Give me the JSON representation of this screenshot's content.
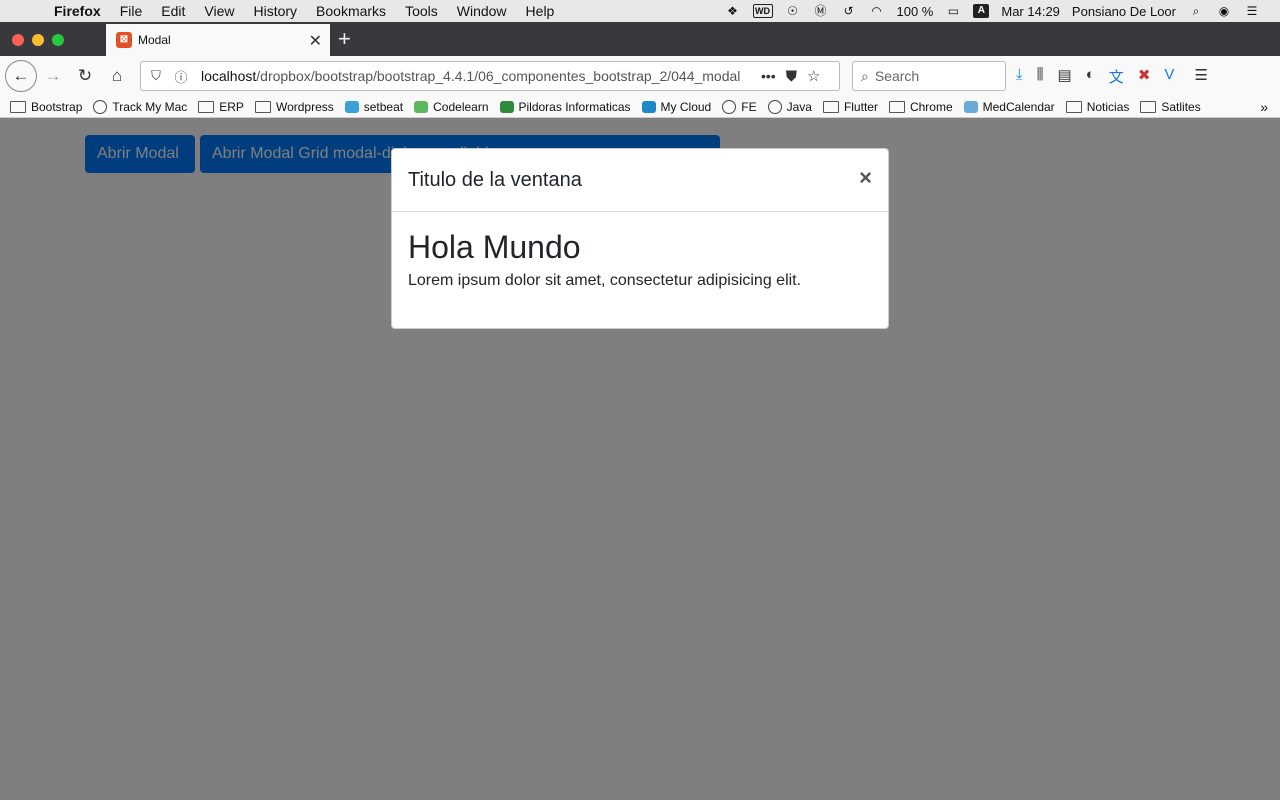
{
  "menubar": {
    "app": "Firefox",
    "items": [
      "File",
      "Edit",
      "View",
      "History",
      "Bookmarks",
      "Tools",
      "Window",
      "Help"
    ],
    "battery": "100 %",
    "input_source": "A",
    "clock": "Mar 14:29",
    "user": "Ponsiano De Loor"
  },
  "tab": {
    "title": "Modal"
  },
  "navbar": {
    "url_host": "localhost",
    "url_path": "/dropbox/bootstrap/bootstrap_4.4.1/06_componentes_bootstrap_2/044_modal",
    "search_placeholder": "Search"
  },
  "bookmarks": {
    "items": [
      {
        "label": "Bootstrap",
        "icon": "folder-icon"
      },
      {
        "label": "Track My Mac",
        "icon": "globe-icon"
      },
      {
        "label": "ERP",
        "icon": "folder-icon"
      },
      {
        "label": "Wordpress",
        "icon": "folder-icon"
      },
      {
        "label": "setbeat",
        "icon": "setbeat-icon"
      },
      {
        "label": "Codelearn",
        "icon": "codelearn-icon"
      },
      {
        "label": "Pildoras Informaticas",
        "icon": "pildoras-icon"
      },
      {
        "label": "My Cloud",
        "icon": "cloud-icon"
      },
      {
        "label": "FE",
        "icon": "globe-icon"
      },
      {
        "label": "Java",
        "icon": "globe-icon"
      },
      {
        "label": "Flutter",
        "icon": "folder-icon"
      },
      {
        "label": "Chrome",
        "icon": "folder-icon"
      },
      {
        "label": "MedCalendar",
        "icon": "medcalendar-icon"
      },
      {
        "label": "Noticias",
        "icon": "folder-icon"
      },
      {
        "label": "Satlites",
        "icon": "folder-icon"
      }
    ]
  },
  "page": {
    "btn_modal": "Abrir Modal",
    "btn_modal_grid": "Abrir Modal Grid modal-dialog-scrollable"
  },
  "modal": {
    "title": "Titulo de la ventana",
    "close": "×",
    "heading": "Hola Mundo",
    "text": "Lorem ipsum dolor sit amet, consectetur adipisicing elit."
  },
  "colors": {
    "primary": "#007bff",
    "backdrop": "#808080",
    "tab_strip": "#38383d"
  }
}
